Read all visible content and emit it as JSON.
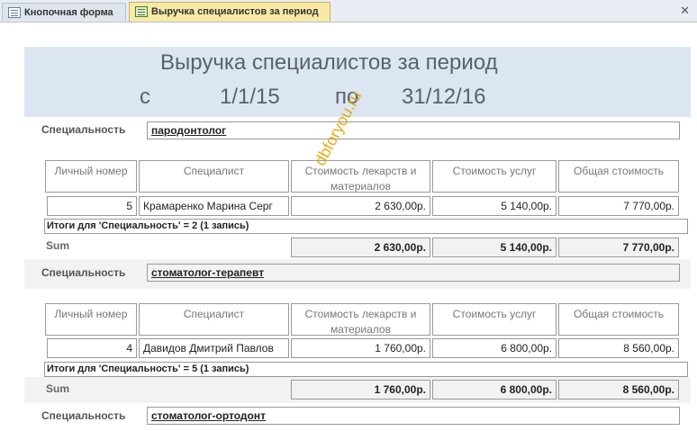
{
  "tabs": [
    {
      "label": "Кнопочная форма",
      "icon": "form-icon"
    },
    {
      "label": "Выручка специалистов за период",
      "icon": "report-icon",
      "active": true
    }
  ],
  "report": {
    "title": "Выручка специалистов за период",
    "from_label": "с",
    "from_date": "1/1/15",
    "to_label": "по",
    "to_date": "31/12/16"
  },
  "columns": [
    "Личный номер",
    "Специалист",
    "Стоимость лекарств и материалов",
    "Стоимость услуг",
    "Общая стоимость"
  ],
  "spec_label": "Специальность",
  "sum_label": "Sum",
  "groups": [
    {
      "specialty": "пародонтолог",
      "rows": [
        {
          "id": "5",
          "name": "Крамаренко Марина Серг",
          "materials": "2 630,00р.",
          "services": "5 140,00р.",
          "total": "7 770,00р."
        }
      ],
      "itogi": "Итоги для 'Специальность' = 2 (1 запись)",
      "sum": {
        "materials": "2 630,00р.",
        "services": "5 140,00р.",
        "total": "7 770,00р."
      }
    },
    {
      "specialty": "стоматолог-терапевт",
      "rows": [
        {
          "id": "4",
          "name": "Давидов Дмитрий Павлов",
          "materials": "1 760,00р.",
          "services": "6 800,00р.",
          "total": "8 560,00р."
        }
      ],
      "itogi": "Итоги для 'Специальность' = 5 (1 запись)",
      "sum": {
        "materials": "1 760,00р.",
        "services": "6 800,00р.",
        "total": "8 560,00р."
      }
    },
    {
      "specialty": "стоматолог-ортодонт"
    }
  ],
  "watermark": "dbforyou.ru"
}
